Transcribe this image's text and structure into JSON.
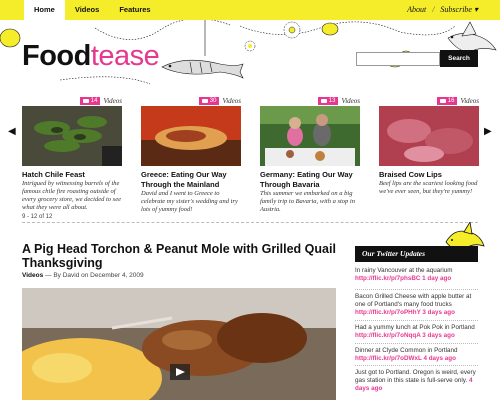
{
  "nav": {
    "home": "Home",
    "videos": "Videos",
    "features": "Features"
  },
  "toplinks": {
    "about": "About",
    "subscribe": "Subscribe ▾",
    "sep": "/"
  },
  "logo": {
    "part1": "Food",
    "part2": "tease"
  },
  "search": {
    "placeholder": "",
    "button": "Search"
  },
  "carousel": {
    "counter": "9 - 12 of 12",
    "cards": [
      {
        "count": "14",
        "category": "Videos",
        "title": "Hatch Chile Feast",
        "desc": "Intrigued by witnessing barrels of the famous chile fire roasting outside of every grocery store, we decided to see what they were all about."
      },
      {
        "count": "30",
        "category": "Videos",
        "title": "Greece: Eating Our Way Through the Mainland",
        "desc": "David and I went to Greece to celebrate my sister's wedding and try lots of yummy food!"
      },
      {
        "count": "13",
        "category": "Videos",
        "title": "Germany: Eating Our Way Through Bavaria",
        "desc": "This summer we embarked on a big family trip to Bavaria, with a stop in Austria."
      },
      {
        "count": "16",
        "category": "Videos",
        "title": "Braised Cow Lips",
        "desc": "Beef lips are the scariest looking food we've ever seen, but they're yummy!"
      }
    ]
  },
  "article": {
    "title": "A Pig Head Torchon & Peanut Mole with Grilled Quail Thanksgiving",
    "category": "Videos",
    "byline_rest": " — By David on December 4, 2009"
  },
  "twitter": {
    "heading": "Our Twitter Updates",
    "tweets": [
      {
        "text": "In rainy Vancouver at the aquarium ",
        "link": "http://flic.kr/p/7phsBC 1 day ago"
      },
      {
        "text": "Bacon Grilled Cheese with apple butter at one of Portland's many food trucks ",
        "link": "http://flic.kr/p/7oPHhY 3 days ago"
      },
      {
        "text": "Had a yummy lunch at Pok Pok in Portland ",
        "link": "http://flic.kr/p/7oNqqA 3 days ago"
      },
      {
        "text": "Dinner at Clyde Common in Portland ",
        "link": "http://flic.kr/p/7oDWxL 4 days ago"
      },
      {
        "text": "Just got to Portland. Oregon is weird, every gas station in this state is full-serve only. ",
        "link": "4 days ago"
      }
    ]
  },
  "colors": {
    "accent": "#e6388f",
    "topbar": "#f5ec2a"
  }
}
